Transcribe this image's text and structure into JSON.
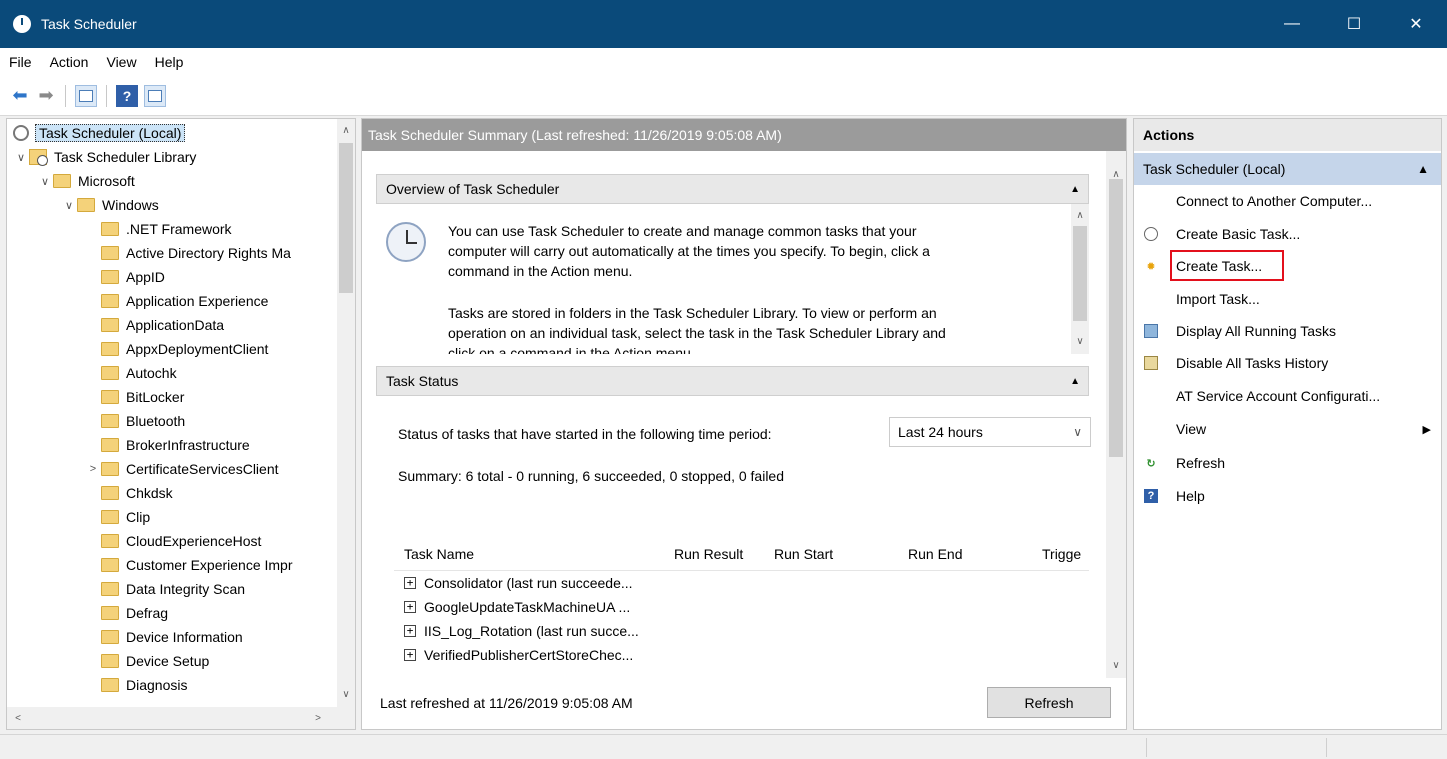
{
  "window": {
    "title": "Task Scheduler",
    "controls": {
      "minimize": "—",
      "maximize": "☐",
      "close": "✕"
    }
  },
  "menu": [
    "File",
    "Action",
    "View",
    "Help"
  ],
  "toolbar": {
    "back_icon": "back-arrow-icon",
    "forward_icon": "forward-arrow-icon",
    "help_glyph": "?"
  },
  "tree": {
    "items": [
      {
        "label": "Task Scheduler (Local)",
        "indent": 0,
        "arrow": "",
        "icon": "root",
        "selected": true
      },
      {
        "label": "Task Scheduler Library",
        "indent": 0,
        "arrow": "∨",
        "icon": "library"
      },
      {
        "label": "Microsoft",
        "indent": 1,
        "arrow": "∨",
        "icon": "folder"
      },
      {
        "label": "Windows",
        "indent": 2,
        "arrow": "∨",
        "icon": "folder"
      },
      {
        "label": ".NET Framework",
        "indent": 3,
        "arrow": "",
        "icon": "folder"
      },
      {
        "label": "Active Directory Rights Ma",
        "indent": 3,
        "arrow": "",
        "icon": "folder"
      },
      {
        "label": "AppID",
        "indent": 3,
        "arrow": "",
        "icon": "folder"
      },
      {
        "label": "Application Experience",
        "indent": 3,
        "arrow": "",
        "icon": "folder"
      },
      {
        "label": "ApplicationData",
        "indent": 3,
        "arrow": "",
        "icon": "folder"
      },
      {
        "label": "AppxDeploymentClient",
        "indent": 3,
        "arrow": "",
        "icon": "folder"
      },
      {
        "label": "Autochk",
        "indent": 3,
        "arrow": "",
        "icon": "folder"
      },
      {
        "label": "BitLocker",
        "indent": 3,
        "arrow": "",
        "icon": "folder"
      },
      {
        "label": "Bluetooth",
        "indent": 3,
        "arrow": "",
        "icon": "folder"
      },
      {
        "label": "BrokerInfrastructure",
        "indent": 3,
        "arrow": "",
        "icon": "folder"
      },
      {
        "label": "CertificateServicesClient",
        "indent": 3,
        "arrow": ">",
        "icon": "folder"
      },
      {
        "label": "Chkdsk",
        "indent": 3,
        "arrow": "",
        "icon": "folder"
      },
      {
        "label": "Clip",
        "indent": 3,
        "arrow": "",
        "icon": "folder"
      },
      {
        "label": "CloudExperienceHost",
        "indent": 3,
        "arrow": "",
        "icon": "folder"
      },
      {
        "label": "Customer Experience Impr",
        "indent": 3,
        "arrow": "",
        "icon": "folder"
      },
      {
        "label": "Data Integrity Scan",
        "indent": 3,
        "arrow": "",
        "icon": "folder"
      },
      {
        "label": "Defrag",
        "indent": 3,
        "arrow": "",
        "icon": "folder"
      },
      {
        "label": "Device Information",
        "indent": 3,
        "arrow": "",
        "icon": "folder"
      },
      {
        "label": "Device Setup",
        "indent": 3,
        "arrow": "",
        "icon": "folder"
      },
      {
        "label": "Diagnosis",
        "indent": 3,
        "arrow": "",
        "icon": "folder"
      }
    ]
  },
  "middle": {
    "header": "Task Scheduler Summary (Last refreshed: 11/26/2019 9:05:08 AM)",
    "overview": {
      "title": "Overview of Task Scheduler",
      "para1_lines": [
        "You can use Task Scheduler to create and manage common tasks that your",
        "computer will carry out automatically at the times you specify. To begin, click a",
        "command in the Action menu."
      ],
      "para2_lines": [
        "Tasks are stored in folders in the Task Scheduler Library. To view or perform an",
        "operation on an individual task, select the task in the Task Scheduler Library and",
        "click on a command in the Action menu."
      ]
    },
    "task_status": {
      "title": "Task Status",
      "period_label": "Status of tasks that have started in the following time period:",
      "period_value": "Last 24 hours",
      "summary": "Summary: 6 total - 0 running, 6 succeeded, 0 stopped, 0 failed",
      "columns": [
        "Task Name",
        "Run Result",
        "Run Start",
        "Run End",
        "Trigge"
      ],
      "rows": [
        "Consolidator (last run succeede...",
        "GoogleUpdateTaskMachineUA ...",
        "IIS_Log_Rotation (last run succe...",
        "VerifiedPublisherCertStoreChec..."
      ]
    },
    "last_refreshed": "Last refreshed at 11/26/2019 9:05:08 AM",
    "refresh_button": "Refresh"
  },
  "actions": {
    "title": "Actions",
    "group": "Task Scheduler (Local)",
    "items": [
      {
        "label": "Connect to Another Computer...",
        "icon": ""
      },
      {
        "label": "Create Basic Task...",
        "icon": "clock-icon"
      },
      {
        "label": "Create Task...",
        "icon": "new-task-icon",
        "highlighted": true
      },
      {
        "label": "Import Task...",
        "icon": ""
      },
      {
        "label": "Display All Running Tasks",
        "icon": "running-tasks-icon"
      },
      {
        "label": "Disable All Tasks History",
        "icon": "history-icon"
      },
      {
        "label": "AT Service Account Configurati...",
        "icon": ""
      },
      {
        "label": "View",
        "icon": "",
        "submenu": true
      },
      {
        "label": "Refresh",
        "icon": "refresh-icon"
      },
      {
        "label": "Help",
        "icon": "help-icon"
      }
    ]
  },
  "colors": {
    "titlebar": "#0a4a7a",
    "highlight_border": "#e3101c",
    "actions_group": "#c5d5ea"
  }
}
